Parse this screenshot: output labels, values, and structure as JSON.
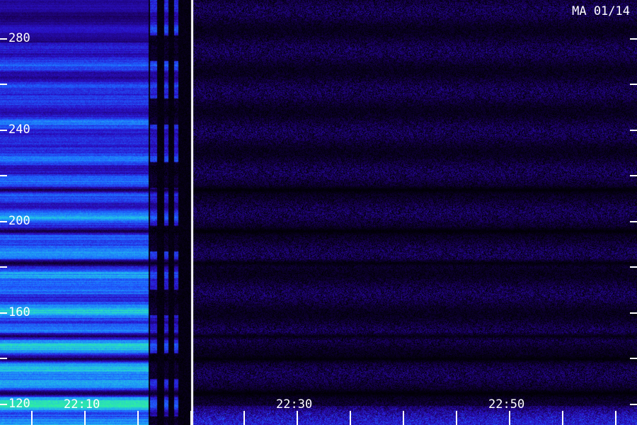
{
  "chart_data": {
    "type": "heatmap",
    "title": "",
    "corner_label": "MA 01/14",
    "xlabel": "",
    "ylabel": "",
    "x_axis": {
      "unit": "time",
      "range": [
        "22:02",
        "23:02"
      ],
      "tick_labels": [
        {
          "label": "22:10",
          "value": "22:10"
        },
        {
          "label": "22:30",
          "value": "22:30"
        },
        {
          "label": "22:50",
          "value": "22:50"
        }
      ],
      "minor_tick_interval_minutes": 5
    },
    "y_axis": {
      "range": [
        111,
        297
      ],
      "tick_values": [
        120,
        160,
        200,
        240,
        280
      ],
      "tick_labels": [
        "120",
        "160",
        "200",
        "240",
        "280"
      ],
      "minor_tick_interval": 20
    },
    "colormap": [
      "#000000",
      "#1a0060",
      "#2a10c8",
      "#1e60ff",
      "#20b8f0",
      "#30f0a0"
    ],
    "grid": false,
    "legend": "none",
    "regions": [
      {
        "description": "strong broadband signal",
        "x_start": "22:02",
        "x_end": "22:16",
        "intensity": "high, strongest near 120"
      },
      {
        "description": "intermittent narrow strips",
        "x_start": "22:16",
        "x_end": "22:20",
        "intensity": "high, on/off"
      },
      {
        "description": "white vertical line",
        "x": "22:20",
        "color": "#ffffff"
      },
      {
        "description": "weak noise background",
        "x_start": "22:20",
        "x_end": "23:02",
        "intensity": "low"
      }
    ],
    "horizontal_dark_bands_at": [
      125,
      140,
      150,
      182,
      196,
      214
    ]
  }
}
